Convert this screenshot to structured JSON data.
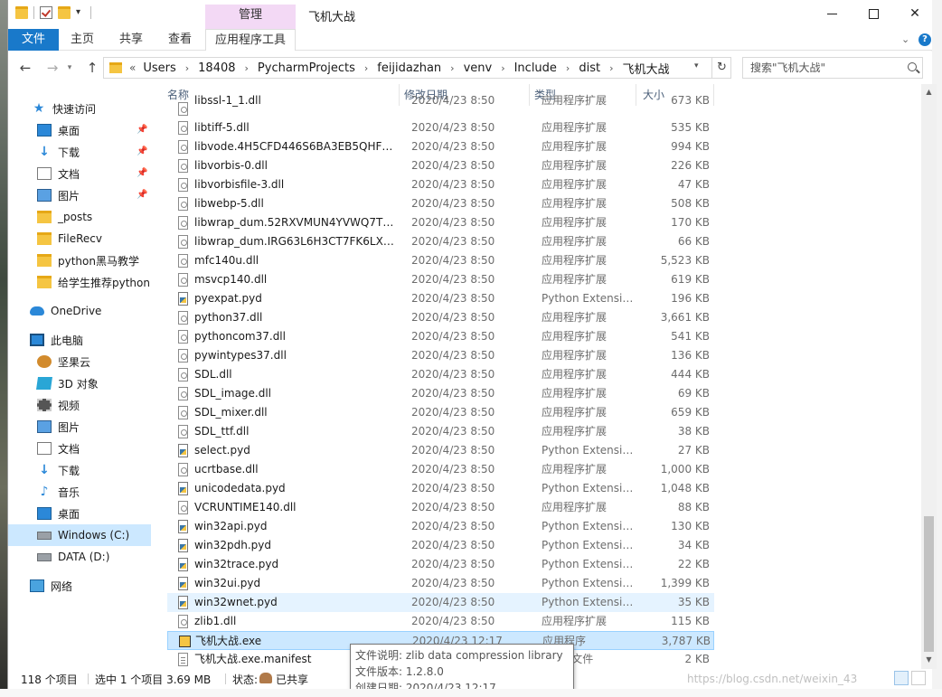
{
  "window": {
    "title": "飞机大战",
    "manage_tab": "管理"
  },
  "ribbon": {
    "tabs": [
      {
        "label": "文件"
      },
      {
        "label": "主页"
      },
      {
        "label": "共享"
      },
      {
        "label": "查看"
      },
      {
        "label": "应用程序工具"
      }
    ]
  },
  "address": {
    "lead": "«",
    "crumbs": [
      "Users",
      "18408",
      "PycharmProjects",
      "feijidazhan",
      "venv",
      "Include",
      "dist",
      "飞机大战"
    ],
    "search_placeholder": "搜索\"飞机大战\""
  },
  "sidebar": {
    "items": [
      {
        "label": "快速访问",
        "icon": "star-icon",
        "pinned": false
      },
      {
        "label": "桌面",
        "icon": "desktop-icon",
        "pinned": true
      },
      {
        "label": "下载",
        "icon": "download-icon",
        "pinned": true
      },
      {
        "label": "文档",
        "icon": "document-icon",
        "pinned": true
      },
      {
        "label": "图片",
        "icon": "pictures-icon",
        "pinned": true
      },
      {
        "label": "_posts",
        "icon": "folder-icon",
        "pinned": false
      },
      {
        "label": "FileRecv",
        "icon": "folder-icon",
        "pinned": false
      },
      {
        "label": "python黑马教学",
        "icon": "folder-icon",
        "pinned": false
      },
      {
        "label": "给学生推荐python",
        "icon": "folder-icon",
        "pinned": false
      },
      {
        "label": "OneDrive",
        "icon": "cloud-icon",
        "pinned": false
      },
      {
        "label": "此电脑",
        "icon": "computer-icon",
        "pinned": false
      },
      {
        "label": "坚果云",
        "icon": "nut-icon",
        "pinned": false
      },
      {
        "label": "3D 对象",
        "icon": "3d-objects-icon",
        "pinned": false
      },
      {
        "label": "视频",
        "icon": "video-icon",
        "pinned": false
      },
      {
        "label": "图片",
        "icon": "pictures-icon",
        "pinned": false
      },
      {
        "label": "文档",
        "icon": "document-icon",
        "pinned": false
      },
      {
        "label": "下载",
        "icon": "download-icon",
        "pinned": false
      },
      {
        "label": "音乐",
        "icon": "music-icon",
        "pinned": false
      },
      {
        "label": "桌面",
        "icon": "desktop-icon",
        "pinned": false
      },
      {
        "label": "Windows (C:)",
        "icon": "drive-icon",
        "pinned": false,
        "selected": true
      },
      {
        "label": "DATA (D:)",
        "icon": "drive-icon",
        "pinned": false
      },
      {
        "label": "网络",
        "icon": "network-icon",
        "pinned": false
      }
    ]
  },
  "columns": {
    "name": "名称",
    "date": "修改日期",
    "type": "类型",
    "size": "大小"
  },
  "files": [
    {
      "name": "libssl-1_1.dll",
      "date": "2020/4/23 8:50",
      "type": "应用程序扩展",
      "size": "673 KB",
      "icon": "dll"
    },
    {
      "name": "libtiff-5.dll",
      "date": "2020/4/23 8:50",
      "type": "应用程序扩展",
      "size": "535 KB",
      "icon": "dll"
    },
    {
      "name": "libvode.4H5CFD446S6BA3EB5QHFUC...",
      "date": "2020/4/23 8:50",
      "type": "应用程序扩展",
      "size": "994 KB",
      "icon": "dll"
    },
    {
      "name": "libvorbis-0.dll",
      "date": "2020/4/23 8:50",
      "type": "应用程序扩展",
      "size": "226 KB",
      "icon": "dll"
    },
    {
      "name": "libvorbisfile-3.dll",
      "date": "2020/4/23 8:50",
      "type": "应用程序扩展",
      "size": "47 KB",
      "icon": "dll"
    },
    {
      "name": "libwebp-5.dll",
      "date": "2020/4/23 8:50",
      "type": "应用程序扩展",
      "size": "508 KB",
      "icon": "dll"
    },
    {
      "name": "libwrap_dum.52RXVMUN4YVWQ7T6...",
      "date": "2020/4/23 8:50",
      "type": "应用程序扩展",
      "size": "170 KB",
      "icon": "dll"
    },
    {
      "name": "libwrap_dum.IRG63L6H3CT7FK6LX5T...",
      "date": "2020/4/23 8:50",
      "type": "应用程序扩展",
      "size": "66 KB",
      "icon": "dll"
    },
    {
      "name": "mfc140u.dll",
      "date": "2020/4/23 8:50",
      "type": "应用程序扩展",
      "size": "5,523 KB",
      "icon": "dll"
    },
    {
      "name": "msvcp140.dll",
      "date": "2020/4/23 8:50",
      "type": "应用程序扩展",
      "size": "619 KB",
      "icon": "dll"
    },
    {
      "name": "pyexpat.pyd",
      "date": "2020/4/23 8:50",
      "type": "Python Extensio...",
      "size": "196 KB",
      "icon": "py"
    },
    {
      "name": "python37.dll",
      "date": "2020/4/23 8:50",
      "type": "应用程序扩展",
      "size": "3,661 KB",
      "icon": "dll"
    },
    {
      "name": "pythoncom37.dll",
      "date": "2020/4/23 8:50",
      "type": "应用程序扩展",
      "size": "541 KB",
      "icon": "dll"
    },
    {
      "name": "pywintypes37.dll",
      "date": "2020/4/23 8:50",
      "type": "应用程序扩展",
      "size": "136 KB",
      "icon": "dll"
    },
    {
      "name": "SDL.dll",
      "date": "2020/4/23 8:50",
      "type": "应用程序扩展",
      "size": "444 KB",
      "icon": "dll"
    },
    {
      "name": "SDL_image.dll",
      "date": "2020/4/23 8:50",
      "type": "应用程序扩展",
      "size": "69 KB",
      "icon": "dll"
    },
    {
      "name": "SDL_mixer.dll",
      "date": "2020/4/23 8:50",
      "type": "应用程序扩展",
      "size": "659 KB",
      "icon": "dll"
    },
    {
      "name": "SDL_ttf.dll",
      "date": "2020/4/23 8:50",
      "type": "应用程序扩展",
      "size": "38 KB",
      "icon": "dll"
    },
    {
      "name": "select.pyd",
      "date": "2020/4/23 8:50",
      "type": "Python Extensio...",
      "size": "27 KB",
      "icon": "py"
    },
    {
      "name": "ucrtbase.dll",
      "date": "2020/4/23 8:50",
      "type": "应用程序扩展",
      "size": "1,000 KB",
      "icon": "dll"
    },
    {
      "name": "unicodedata.pyd",
      "date": "2020/4/23 8:50",
      "type": "Python Extensio...",
      "size": "1,048 KB",
      "icon": "py"
    },
    {
      "name": "VCRUNTIME140.dll",
      "date": "2020/4/23 8:50",
      "type": "应用程序扩展",
      "size": "88 KB",
      "icon": "dll"
    },
    {
      "name": "win32api.pyd",
      "date": "2020/4/23 8:50",
      "type": "Python Extensio...",
      "size": "130 KB",
      "icon": "py"
    },
    {
      "name": "win32pdh.pyd",
      "date": "2020/4/23 8:50",
      "type": "Python Extensio...",
      "size": "34 KB",
      "icon": "py"
    },
    {
      "name": "win32trace.pyd",
      "date": "2020/4/23 8:50",
      "type": "Python Extensio...",
      "size": "22 KB",
      "icon": "py"
    },
    {
      "name": "win32ui.pyd",
      "date": "2020/4/23 8:50",
      "type": "Python Extensio...",
      "size": "1,399 KB",
      "icon": "py"
    },
    {
      "name": "win32wnet.pyd",
      "date": "2020/4/23 8:50",
      "type": "Python Extensio...",
      "size": "35 KB",
      "icon": "py",
      "hover": true
    },
    {
      "name": "zlib1.dll",
      "date": "2020/4/23 8:50",
      "type": "应用程序扩展",
      "size": "115 KB",
      "icon": "dll"
    },
    {
      "name": "飞机大战.exe",
      "date": "2020/4/23 12:17",
      "type": "应用程序",
      "size": "3,787 KB",
      "icon": "exe",
      "selected": true
    },
    {
      "name": "飞机大战.exe.manifest",
      "date": "",
      "type": "FEST 文件",
      "size": "2 KB",
      "icon": "manifest"
    }
  ],
  "tooltip": {
    "lines": [
      "文件说明: zlib data compression library",
      "文件版本: 1.2.8.0",
      "创建日期: 2020/4/23 12:17"
    ]
  },
  "status": {
    "count": "118 个项目",
    "selected": "选中 1 个项目  3.69 MB",
    "state_label": "状态:",
    "state_value": "已共享"
  },
  "watermark": "https://blog.csdn.net/weixin_43"
}
